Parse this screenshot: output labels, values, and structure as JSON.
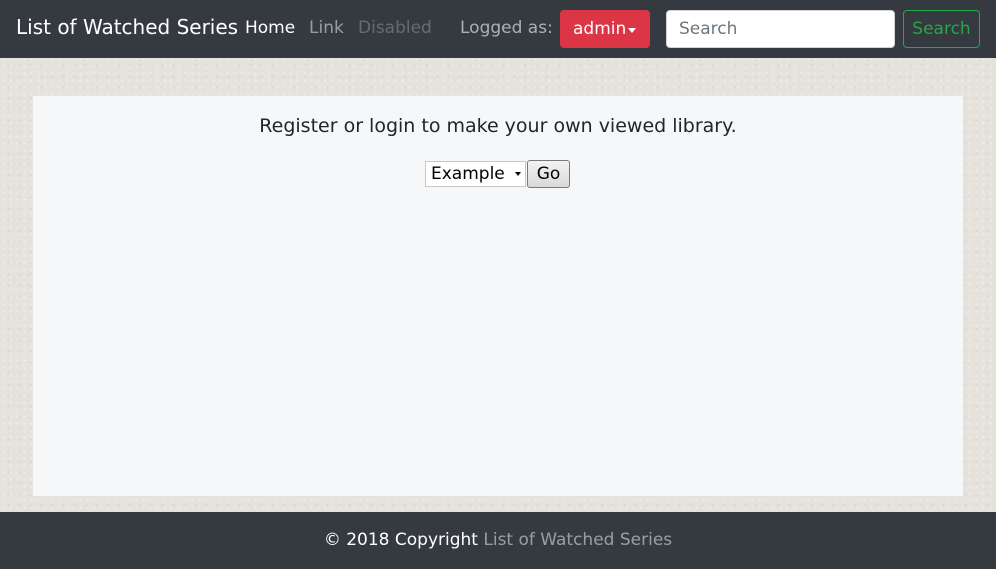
{
  "navbar": {
    "brand": "List of Watched Series",
    "links": {
      "home": "Home",
      "link": "Link",
      "disabled": "Disabled"
    },
    "logged_as_label": "Logged as:",
    "user_button_label": "admin",
    "search": {
      "placeholder": "Search",
      "value": "",
      "button_label": "Search"
    }
  },
  "main": {
    "intro_text": "Register or login to make your own viewed library.",
    "select": {
      "selected": "Example"
    },
    "go_button_label": "Go"
  },
  "footer": {
    "copyright_text": "© 2018 Copyright",
    "link_text": "List of Watched Series"
  },
  "colors": {
    "navbar_bg": "#343a40",
    "danger": "#dc3545",
    "success": "#28a745",
    "card_bg": "#f6f7f9",
    "page_bg": "#e5e2dc"
  },
  "icons": {
    "user_dropdown": "caret-down-icon",
    "select_dropdown": "caret-down-icon"
  }
}
